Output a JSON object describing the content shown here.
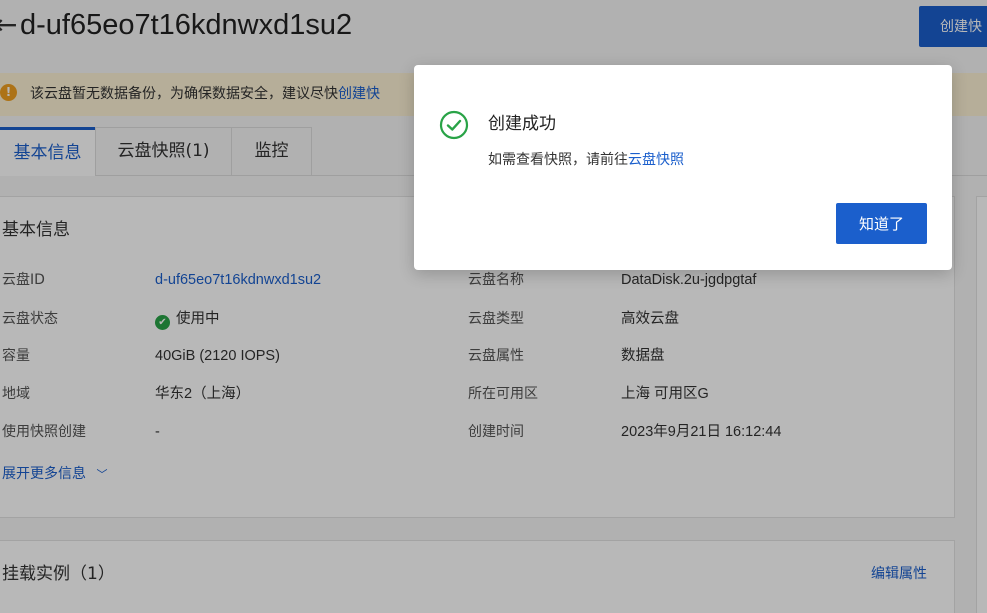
{
  "header": {
    "title": "d-uf65eo7t16kdnwxd1su2",
    "create_button": "创建快"
  },
  "banner": {
    "text": "该云盘暂无数据备份，为确保数据安全，建议尽快",
    "link": "创建快"
  },
  "tabs": [
    {
      "label": "基本信息",
      "active": true
    },
    {
      "label": "云盘快照(1)",
      "active": false
    },
    {
      "label": "监控",
      "active": false
    }
  ],
  "basic": {
    "title": "基本信息",
    "left": [
      {
        "label": "云盘ID",
        "value": "d-uf65eo7t16kdnwxd1su2"
      },
      {
        "label": "云盘状态",
        "value": "使用中"
      },
      {
        "label": "容量",
        "value": "40GiB (2120 IOPS)"
      },
      {
        "label": "地域",
        "value": "华东2（上海）"
      },
      {
        "label": "使用快照创建",
        "value": "-"
      }
    ],
    "right": [
      {
        "label": "云盘名称",
        "value": "DataDisk.2u-jgdpgtaf"
      },
      {
        "label": "云盘类型",
        "value": "高效云盘"
      },
      {
        "label": "云盘属性",
        "value": "数据盘"
      },
      {
        "label": "所在可用区",
        "value": "上海 可用区G"
      },
      {
        "label": "创建时间",
        "value": "2023年9月21日 16:12:44"
      }
    ],
    "expand": "展开更多信息",
    "expand_icon": "chevron-down-icon"
  },
  "mount": {
    "title": "挂载实例（1）",
    "edit": "编辑属性"
  },
  "modal": {
    "title": "创建成功",
    "message": "如需查看快照，请前往",
    "link": "云盘快照",
    "ok_button": "知道了",
    "icon": "check-circle-icon"
  },
  "colors": {
    "accent": "#1b5fcc",
    "success": "#29a347",
    "warning": "#f0a020",
    "banner_bg": "#fcf1d4"
  }
}
